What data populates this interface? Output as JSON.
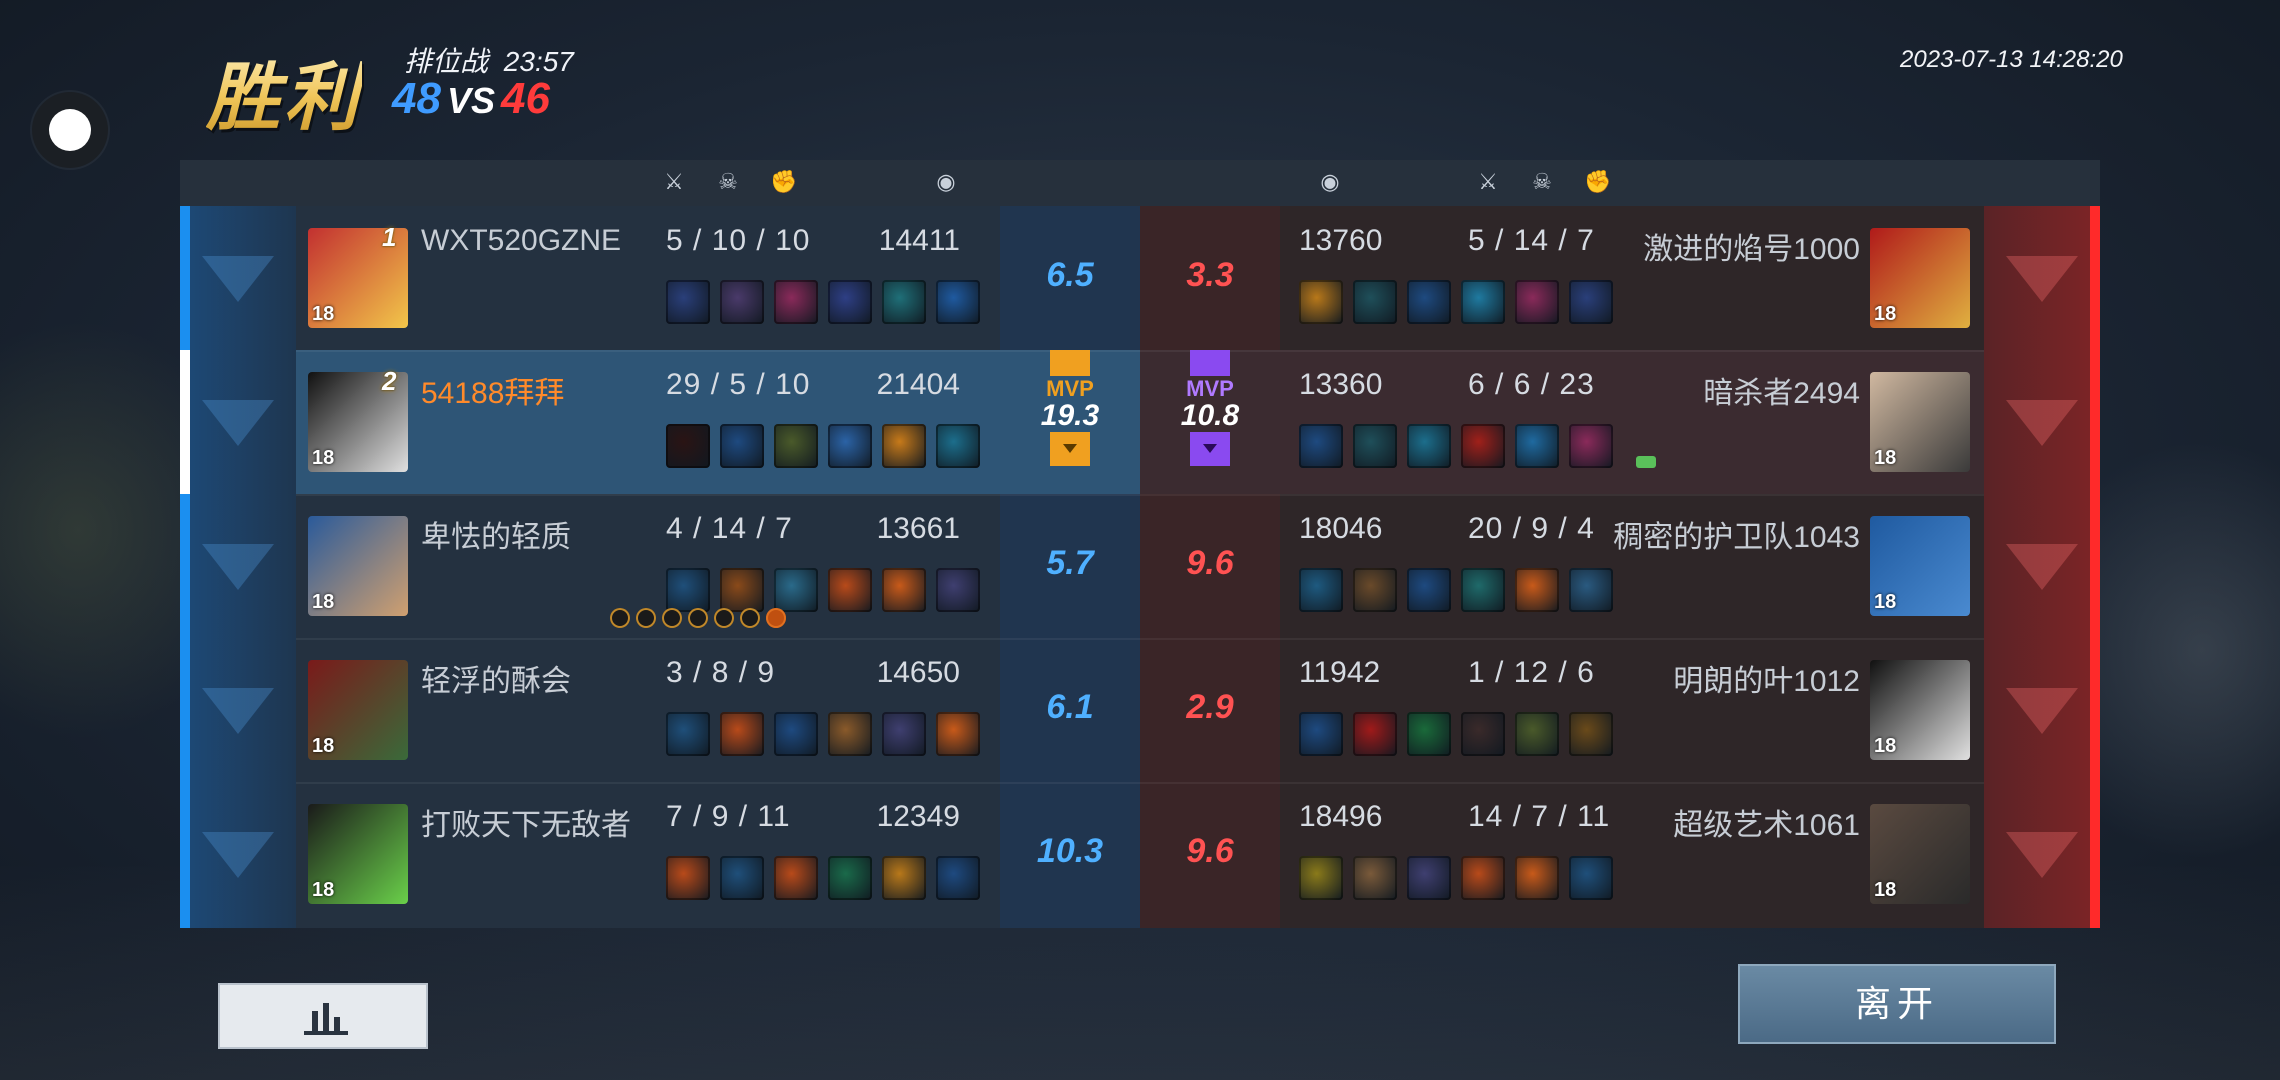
{
  "header": {
    "result": "胜利",
    "mode": "排位战",
    "duration": "23:57",
    "blue_score": "48",
    "vs": "VS",
    "red_score": "46",
    "datetime": "2023-07-13 14:28:20"
  },
  "columns": {
    "kills_icon": "crossed-swords-icon",
    "deaths_icon": "skull-icon",
    "assists_icon": "fist-icon",
    "gold_icon": "gold-coin-icon"
  },
  "blue_team": [
    {
      "name": "WXT520GZNE",
      "level": "18",
      "rank": "1",
      "k": "5",
      "d": "10",
      "a": "10",
      "gold": "14411",
      "rating": "6.5",
      "items": [
        "#2a3f7a",
        "#4a3a6a",
        "#8a2a5a",
        "#2e3f85",
        "#1f6f78",
        "#1f5aa0"
      ],
      "avatar": [
        "#c23030",
        "#f2c64a"
      ]
    },
    {
      "name": "54188拜拜",
      "level": "18",
      "rank": "2",
      "k": "29",
      "d": "5",
      "a": "10",
      "gold": "21404",
      "mvp": "MVP",
      "rating": "19.3",
      "items": [
        "#2a1414",
        "#1e4a80",
        "#4a5a2a",
        "#2b63a6",
        "#c77a1a",
        "#1c6e8c"
      ],
      "avatar": [
        "#111111",
        "#e0e0e0"
      ]
    },
    {
      "name": "卑怯的轻质",
      "level": "18",
      "k": "4",
      "d": "14",
      "a": "7",
      "gold": "13661",
      "rating": "5.7",
      "items": [
        "#1f4f7a",
        "#8a4a1a",
        "#2a6a8a",
        "#b84a1a",
        "#c85a1a",
        "#3f3f70"
      ],
      "avatar": [
        "#2a5a9a",
        "#d0a070"
      ]
    },
    {
      "name": "轻浮的酥会",
      "level": "18",
      "k": "3",
      "d": "8",
      "a": "9",
      "gold": "14650",
      "rating": "6.1",
      "items": [
        "#1f4f7a",
        "#b84a1a",
        "#1e4a80",
        "#8a5a2a",
        "#3f3f70",
        "#c85a1a"
      ],
      "avatar": [
        "#7a1a1a",
        "#3a6a3a"
      ]
    },
    {
      "name": "打败天下无敌者",
      "level": "18",
      "k": "7",
      "d": "9",
      "a": "11",
      "gold": "12349",
      "rating": "10.3",
      "items": [
        "#b84a1a",
        "#1f4f7a",
        "#b84a1a",
        "#1a6a4a",
        "#b8781a",
        "#1e4a80"
      ],
      "avatar": [
        "#1a1a1a",
        "#6ad04a"
      ]
    }
  ],
  "red_team": [
    {
      "name": "激进的焰号1000",
      "level": "18",
      "k": "5",
      "d": "14",
      "a": "7",
      "gold": "13760",
      "rating": "3.3",
      "items": [
        "#b8781a",
        "#1f4f5a",
        "#1e4a80",
        "#1f7aa0",
        "#8a2a5a",
        "#2a3f7a"
      ],
      "avatar": [
        "#b01a1a",
        "#e0b040"
      ]
    },
    {
      "name": "暗杀者2494",
      "level": "18",
      "k": "6",
      "d": "6",
      "a": "23",
      "gold": "13360",
      "mvp": "MVP",
      "rating": "10.8",
      "items": [
        "#1e4a80",
        "#1f4f5a",
        "#1c6e8c",
        "#a0201a",
        "#1f6aa0",
        "#8a2a5a"
      ],
      "avatar": [
        "#d0b8a0",
        "#3a3a3a"
      ]
    },
    {
      "name": "稠密的护卫队1043",
      "level": "18",
      "k": "20",
      "d": "9",
      "a": "4",
      "gold": "18046",
      "rating": "9.6",
      "items": [
        "#1e5a80",
        "#6a4a2a",
        "#1e4a80",
        "#1f6a6a",
        "#c85a1a",
        "#2a5a80"
      ],
      "avatar": [
        "#1f5aa0",
        "#4a8ad0"
      ]
    },
    {
      "name": "明朗的叶1012",
      "level": "18",
      "k": "1",
      "d": "12",
      "a": "6",
      "gold": "11942",
      "rating": "2.9",
      "items": [
        "#1e4a80",
        "#a01a1a",
        "#1a6a3a",
        "#3a2a2a",
        "#4a5a2a",
        "#6a4a1a"
      ],
      "avatar": [
        "#111111",
        "#e0e0e0"
      ]
    },
    {
      "name": "超级艺术1061",
      "level": "18",
      "k": "14",
      "d": "7",
      "a": "11",
      "gold": "18496",
      "rating": "9.6",
      "items": [
        "#8a7a1a",
        "#7a5a3a",
        "#3f3f70",
        "#b84a1a",
        "#c85a1a",
        "#1f4f7a"
      ],
      "avatar": [
        "#5a4a40",
        "#2a2a2a"
      ]
    }
  ],
  "buttons": {
    "stats_icon": "bar-chart-icon",
    "leave": "离开"
  },
  "colors": {
    "blue_accent": "#1b8ff0",
    "red_accent": "#ff2a2a",
    "mvp_blue_team": "#f0a020",
    "mvp_red_team": "#8a4af0"
  }
}
